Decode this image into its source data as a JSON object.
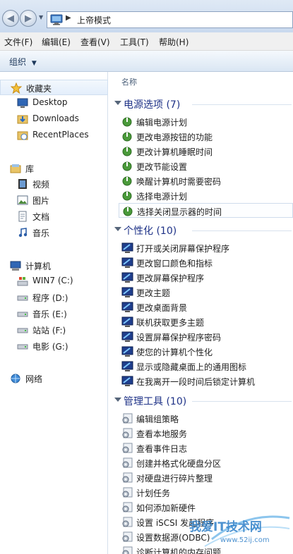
{
  "address": {
    "location_icon": "control-panel-icon",
    "location": "上帝模式"
  },
  "menu": [
    "文件(F)",
    "编辑(E)",
    "查看(V)",
    "工具(T)",
    "帮助(H)"
  ],
  "toolbar": {
    "organize_label": "组织"
  },
  "column_header": "名称",
  "nav": {
    "favorites": {
      "label": "收藏夹",
      "icon": "star-icon",
      "items": [
        {
          "label": "Desktop",
          "icon": "desktop-icon"
        },
        {
          "label": "Downloads",
          "icon": "downloads-folder-icon"
        },
        {
          "label": "RecentPlaces",
          "icon": "recent-places-icon"
        }
      ]
    },
    "libraries": {
      "label": "库",
      "icon": "library-icon",
      "items": [
        {
          "label": "视频",
          "icon": "video-icon"
        },
        {
          "label": "图片",
          "icon": "picture-icon"
        },
        {
          "label": "文档",
          "icon": "document-icon"
        },
        {
          "label": "音乐",
          "icon": "music-icon"
        }
      ]
    },
    "computer": {
      "label": "计算机",
      "icon": "computer-icon",
      "items": [
        {
          "label": "WIN7 (C:)",
          "icon": "system-drive-icon"
        },
        {
          "label": "程序 (D:)",
          "icon": "drive-icon"
        },
        {
          "label": "音乐 (E:)",
          "icon": "drive-icon"
        },
        {
          "label": "站站 (F:)",
          "icon": "drive-icon"
        },
        {
          "label": "电影 (G:)",
          "icon": "drive-icon"
        }
      ]
    },
    "network": {
      "label": "网络",
      "icon": "network-icon"
    }
  },
  "groups": [
    {
      "title": "电源选项 (7)",
      "icon": "power-options-icon",
      "items": [
        "编辑电源计划",
        "更改电源按钮的功能",
        "更改计算机睡眠时间",
        "更改节能设置",
        "唤醒计算机时需要密码",
        "选择电源计划",
        "选择关闭显示器的时间"
      ]
    },
    {
      "title": "个性化 (10)",
      "icon": "personalization-icon",
      "items": [
        "打开或关闭屏幕保护程序",
        "更改窗口颜色和指标",
        "更改屏幕保护程序",
        "更改主题",
        "更改桌面背景",
        "联机获取更多主题",
        "设置屏幕保护程序密码",
        "使您的计算机个性化",
        "显示或隐藏桌面上的通用图标",
        "在我离开一段时间后锁定计算机"
      ]
    },
    {
      "title": "管理工具 (10)",
      "icon": "admin-tools-icon",
      "items": [
        "编辑组策略",
        "查看本地服务",
        "查看事件日志",
        "创建并格式化硬盘分区",
        "对硬盘进行碎片整理",
        "计划任务",
        "如何添加新硬件",
        "设置 iSCSI 发起程序",
        "设置数据源(ODBC)",
        "诊断计算机的内存问题"
      ]
    }
  ],
  "watermark": {
    "text": "我爱IT技术网",
    "url": "www.52ij.com"
  }
}
